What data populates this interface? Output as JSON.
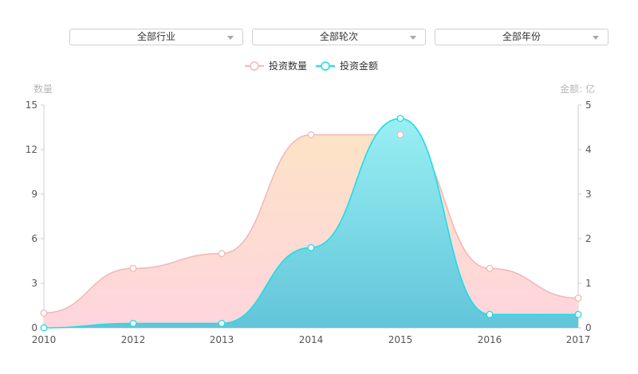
{
  "filters": [
    {
      "label": "全部行业"
    },
    {
      "label": "全部轮次"
    },
    {
      "label": "全部年份"
    }
  ],
  "colors": {
    "count_line": "#f3b8b8",
    "count_fill_top": "#fde3c6",
    "count_fill_bottom": "#fed5de",
    "amount_line": "#22dbe6",
    "amount_fill_top": "#99eff3",
    "amount_fill_bottom": "#61c5d9"
  },
  "chart_data": {
    "type": "area",
    "x": [
      "2010",
      "2012",
      "2013",
      "2014",
      "2015",
      "2016",
      "2017"
    ],
    "series": [
      {
        "name": "投资数量",
        "axis": "left",
        "values": [
          1,
          4,
          5,
          13,
          13,
          4,
          2
        ]
      },
      {
        "name": "投资金额",
        "axis": "right",
        "values": [
          0,
          0.1,
          0.1,
          1.8,
          4.7,
          0.3,
          0.3
        ]
      }
    ],
    "y_left": {
      "name": "数量",
      "ylim": [
        0,
        15
      ],
      "ticks": [
        0,
        3,
        6,
        9,
        12,
        15
      ]
    },
    "y_right": {
      "name": "金额: 亿",
      "ylim": [
        0,
        5
      ],
      "ticks": [
        0,
        1,
        2,
        3,
        4,
        5
      ]
    },
    "legend_position": "top-center",
    "grid": false,
    "smooth": true
  }
}
